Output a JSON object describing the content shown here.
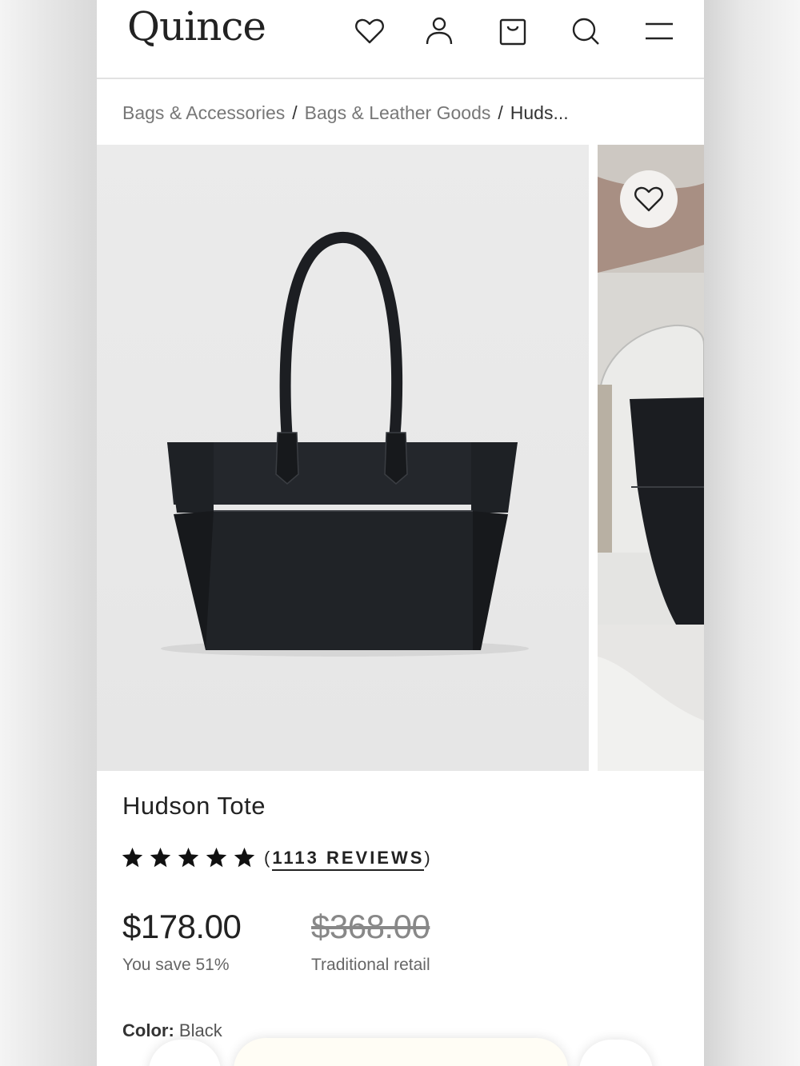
{
  "header": {
    "logo": "Quince",
    "icons": [
      "heart-icon",
      "account-icon",
      "shopping-bag-icon",
      "search-icon",
      "menu-icon"
    ]
  },
  "breadcrumb": {
    "items": [
      "Bags & Accessories",
      "Bags & Leather Goods",
      "Huds..."
    ],
    "separator": "/"
  },
  "product": {
    "title": "Hudson Tote",
    "rating": 5,
    "reviews_open": "(",
    "reviews_label": "1113 REVIEWS",
    "reviews_close": ")",
    "price": "$178.00",
    "savings": "You save 51%",
    "retail_price": "$368.00",
    "retail_label": "Traditional retail",
    "color_label": "Color:",
    "color_value": "Black"
  },
  "colors": {
    "text": "#222222",
    "muted": "#777777",
    "image_bg": "#e8e8e8",
    "bag": "#1b1d21"
  }
}
